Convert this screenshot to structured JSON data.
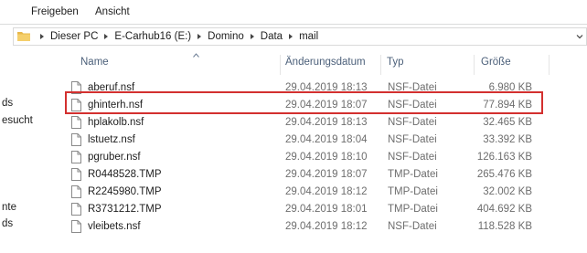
{
  "ribbon": {
    "tabs": [
      "Freigeben",
      "Ansicht"
    ]
  },
  "address": {
    "crumbs": [
      "Dieser PC",
      "E-Carhub16 (E:)",
      "Domino",
      "Data",
      "mail"
    ]
  },
  "nav": {
    "items": [
      "ds",
      "esucht",
      "nte",
      "ds"
    ]
  },
  "columns": {
    "name": "Name",
    "date": "Änderungsdatum",
    "type": "Typ",
    "size": "Größe"
  },
  "files": [
    {
      "name": "aberuf.nsf",
      "date": "29.04.2019 18:13",
      "type": "NSF-Datei",
      "size": "6.980 KB"
    },
    {
      "name": "ghinterh.nsf",
      "date": "29.04.2019 18:07",
      "type": "NSF-Datei",
      "size": "77.894 KB"
    },
    {
      "name": "hplakolb.nsf",
      "date": "29.04.2019 18:13",
      "type": "NSF-Datei",
      "size": "32.465 KB"
    },
    {
      "name": "lstuetz.nsf",
      "date": "29.04.2019 18:04",
      "type": "NSF-Datei",
      "size": "33.392 KB"
    },
    {
      "name": "pgruber.nsf",
      "date": "29.04.2019 18:10",
      "type": "NSF-Datei",
      "size": "126.163 KB"
    },
    {
      "name": "R0448528.TMP",
      "date": "29.04.2019 18:07",
      "type": "TMP-Datei",
      "size": "265.476 KB"
    },
    {
      "name": "R2245980.TMP",
      "date": "29.04.2019 18:12",
      "type": "TMP-Datei",
      "size": "32.002 KB"
    },
    {
      "name": "R3731212.TMP",
      "date": "29.04.2019 18:01",
      "type": "TMP-Datei",
      "size": "404.692 KB"
    },
    {
      "name": "vleibets.nsf",
      "date": "29.04.2019 18:12",
      "type": "NSF-Datei",
      "size": "118.528 KB"
    }
  ],
  "highlighted_file": "ghinterh.nsf",
  "colors": {
    "highlight": "#d3302f",
    "header_text": "#4c607a",
    "folder_yellow": "#e8b84a"
  },
  "icons": {
    "folder": "folder-icon",
    "file": "file-icon",
    "sort": "sort-ascending-icon",
    "breadcrumb_sep": "chevron-right-icon",
    "dropdown": "chevron-down-icon"
  }
}
